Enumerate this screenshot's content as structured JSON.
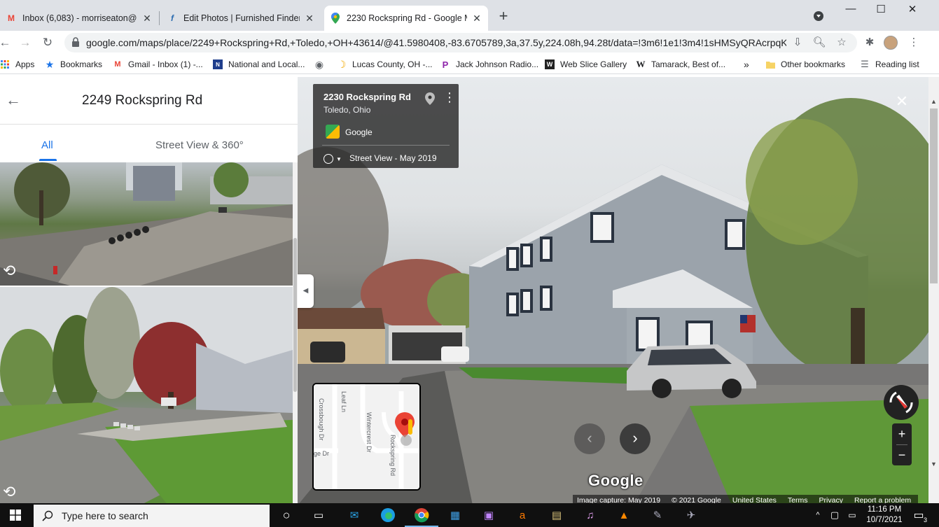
{
  "browser": {
    "tabs": [
      {
        "label": "Inbox (6,083) - morriseaton@gm",
        "icon": "gmail-icon",
        "active": false
      },
      {
        "label": "Edit Photos | Furnished Finder",
        "icon": "furnished-finder-icon",
        "active": false
      },
      {
        "label": "2230 Rockspring Rd - Google Ma",
        "icon": "google-maps-icon",
        "active": true
      }
    ],
    "new_tab": "+",
    "window_controls": {
      "minimize": "—",
      "maximize": "☐",
      "close": "✕"
    },
    "url": "google.com/maps/place/2249+Rockspring+Rd,+Toledo,+OH+43614/@41.5980408,-83.6705789,3a,37.5y,224.08h,94.28t/data=!3m6!1e1!3m4!1sHMSyQRAcrpqKB...",
    "bookmarks": [
      {
        "label": "Apps",
        "icon": "apps-grid-icon"
      },
      {
        "label": "Bookmarks",
        "icon": "star-icon"
      },
      {
        "label": "Gmail - Inbox (1) -...",
        "icon": "gmail-icon"
      },
      {
        "label": "National and Local...",
        "icon": "news-icon"
      },
      {
        "label": "",
        "icon": "globe-icon"
      },
      {
        "label": "Lucas County, OH -...",
        "icon": "moon-icon"
      },
      {
        "label": "Jack Johnson Radio...",
        "icon": "pandora-icon"
      },
      {
        "label": "Web Slice Gallery",
        "icon": "web-slice-icon"
      },
      {
        "label": "Tamarack, Best of...",
        "icon": "wikipedia-icon"
      }
    ],
    "bookmarks_overflow": "»",
    "other_bookmarks": "Other bookmarks",
    "reading_list": "Reading list"
  },
  "left_panel": {
    "title": "2249 Rockspring Rd",
    "tabs": [
      {
        "label": "All",
        "active": true
      },
      {
        "label": "Street View & 360°",
        "active": false
      }
    ]
  },
  "street_view": {
    "card": {
      "address": "2230 Rockspring Rd",
      "city": "Toledo, Ohio",
      "provider": "Google",
      "date_label": "Street View - May 2019"
    },
    "minimap_streets": [
      "Leaf Ln",
      "Crossbough Dr",
      "Wintercrest Dr",
      "Rockspring Rd",
      "ge Dr"
    ],
    "wordmark": "Google",
    "footer": [
      "Image capture: May 2019",
      "© 2021 Google",
      "United States",
      "Terms",
      "Privacy",
      "Report a problem"
    ]
  },
  "taskbar": {
    "search_placeholder": "Type here to search",
    "time": "11:16 PM",
    "date": "10/7/2021",
    "notification_count": "3"
  },
  "colors": {
    "accent_blue": "#1a73e8",
    "tab_strip": "#dee1e6",
    "taskbar": "#101010"
  }
}
